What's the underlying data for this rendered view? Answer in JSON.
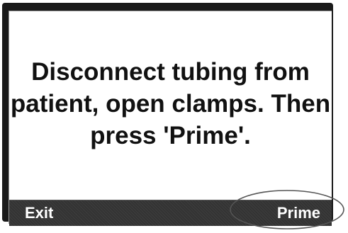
{
  "message": {
    "lines": [
      "Disconnect tubing from",
      "patient, open clamps. Then",
      "press 'Prime'."
    ]
  },
  "softkeys": {
    "left_label": "Exit",
    "right_label": "Prime"
  },
  "colors": {
    "frame": "#1a1a1a",
    "screen_background": "#ffffff",
    "message_text": "#111111",
    "softkey_bar": "#333333",
    "softkey_text": "#ffffff",
    "annotation_ellipse": "#555555"
  },
  "annotation": {
    "shape": "ellipse",
    "highlights": "softkey-prime"
  }
}
